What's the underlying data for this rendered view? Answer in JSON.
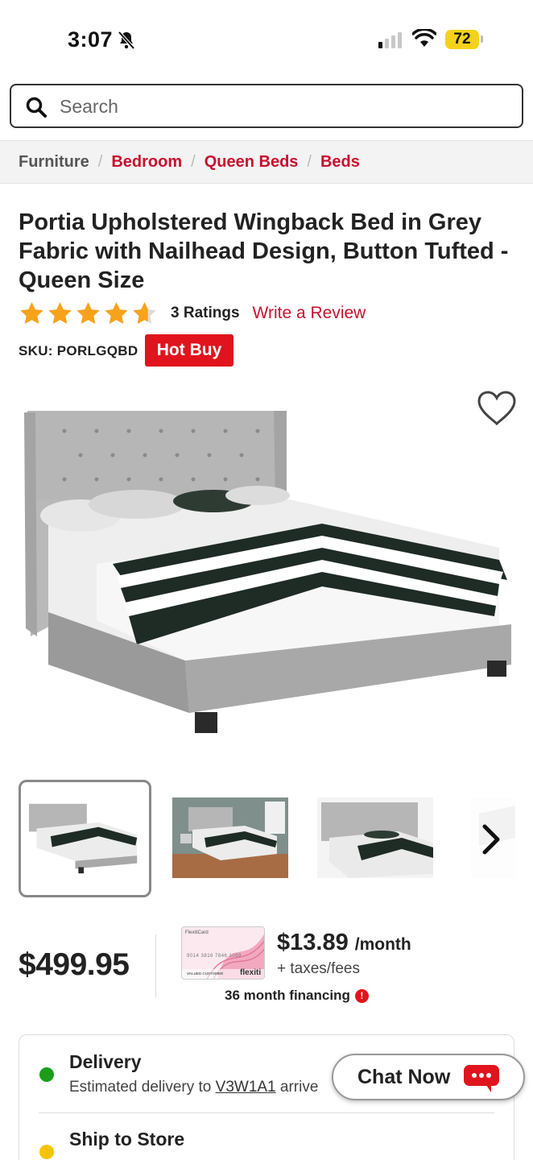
{
  "status_bar": {
    "time": "3:07",
    "battery": "72"
  },
  "search": {
    "placeholder": "Search"
  },
  "breadcrumb": [
    {
      "label": "Furniture"
    },
    {
      "label": "Bedroom"
    },
    {
      "label": "Queen Beds"
    },
    {
      "label": "Beds"
    }
  ],
  "breadcrumb_separator": "/",
  "product": {
    "title": "Portia Upholstered Wingback Bed in Grey Fabric with Nailhead Design, Button Tufted - Queen Size",
    "rating_value": 4.5,
    "ratings_count": "3 Ratings",
    "write_review": "Write a Review",
    "sku": "SKU: PORLGQBD",
    "badge": "Hot Buy",
    "price": "$499.95"
  },
  "financing": {
    "monthly_amount": "$13.89",
    "monthly_unit": "/month",
    "taxes": "+ taxes/fees",
    "term": "36 month financing",
    "card_brand": "flexiti",
    "card_label": "FlexitiCard",
    "card_number": "9014 3816 7846 1059",
    "card_holder": "VALUED CUSTOMER"
  },
  "fulfillment": {
    "delivery": {
      "title": "Delivery",
      "subtitle_prefix": "Estimated delivery to ",
      "postal_code": "V3W1A1",
      "subtitle_suffix": " arrive",
      "status_color": "#1a9e1a"
    },
    "store": {
      "title": "Ship to Store",
      "status_color": "#f5c400"
    }
  },
  "chat": {
    "label": "Chat Now"
  },
  "colors": {
    "accent": "#c8102e",
    "hot_buy": "#e1141d",
    "star": "#f7a21b"
  }
}
